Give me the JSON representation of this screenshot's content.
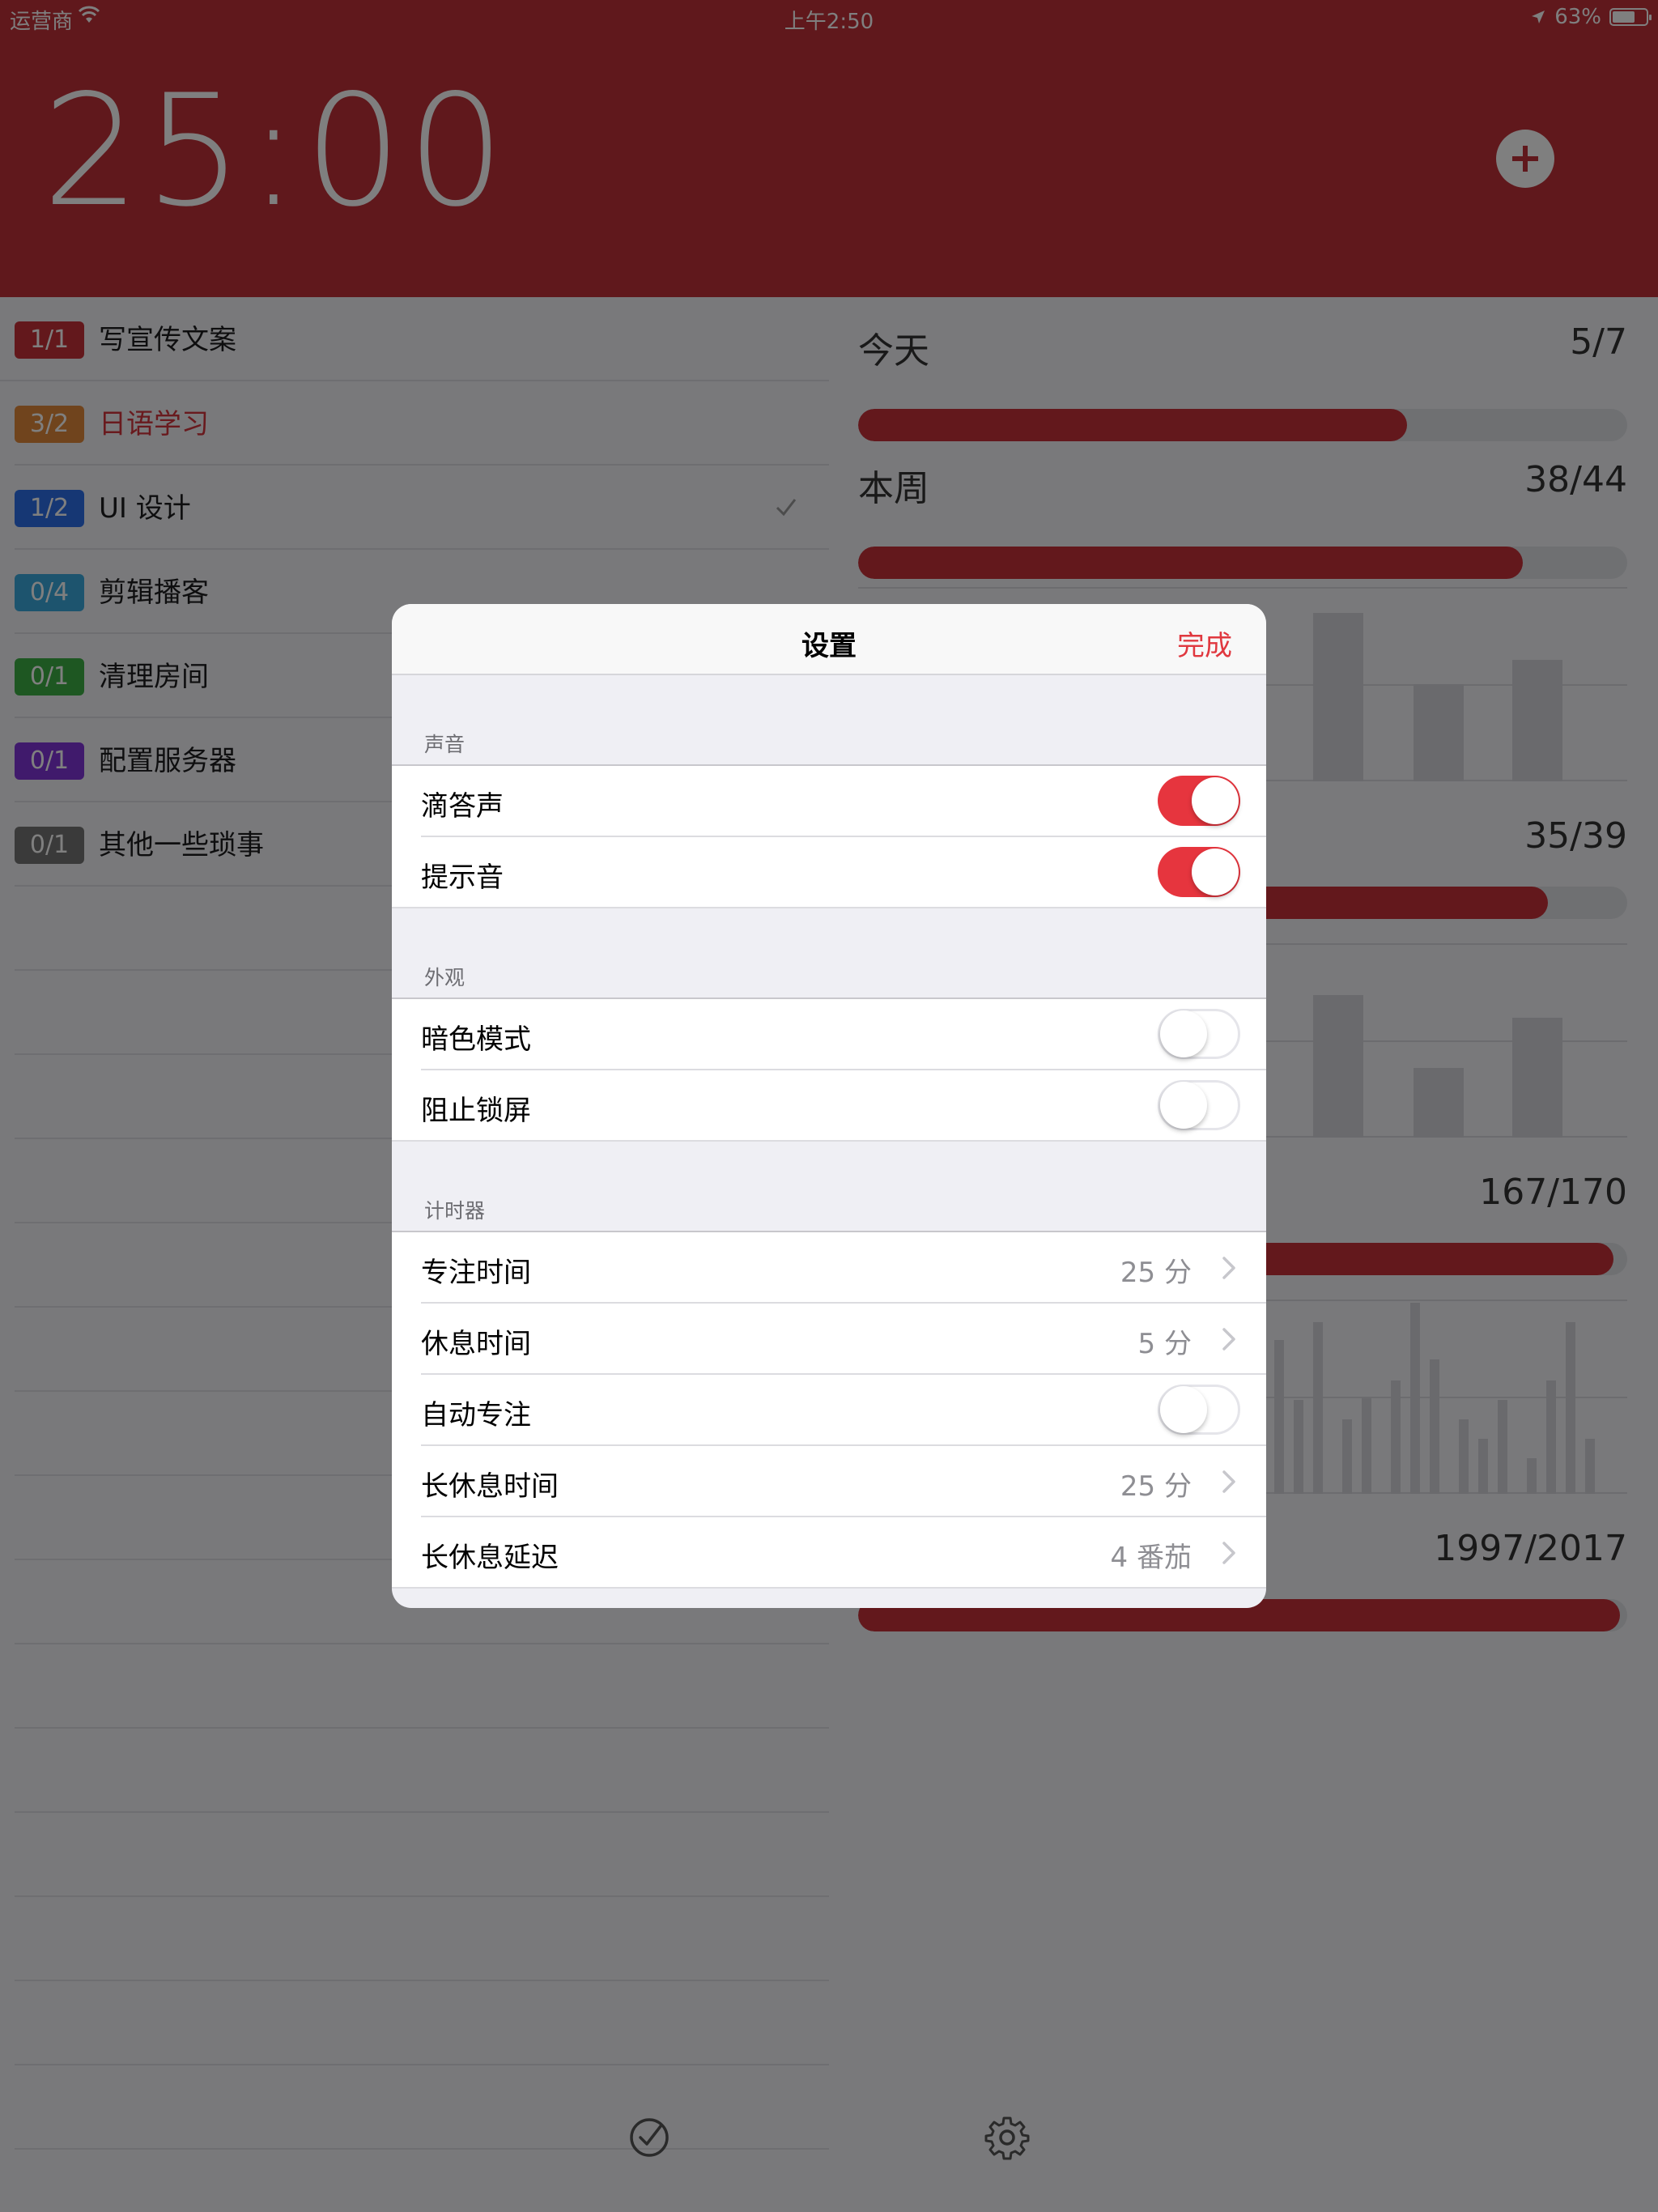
{
  "status_bar": {
    "carrier": "运营商",
    "time": "上午2:50",
    "battery": "63%"
  },
  "timer": {
    "value": "25:00"
  },
  "tasks": [
    {
      "badge": "1/1",
      "name": "写宣传文案",
      "color": "#c63038",
      "text_color": "#1c1c1e",
      "checked": false
    },
    {
      "badge": "3/2",
      "name": "日语学习",
      "color": "#e0883a",
      "text_color": "#d2343c",
      "checked": false
    },
    {
      "badge": "1/2",
      "name": "UI 设计",
      "color": "#2d6fe8",
      "text_color": "#1c1c1e",
      "checked": true
    },
    {
      "badge": "0/4",
      "name": "剪辑播客",
      "color": "#3aa9dc",
      "text_color": "#1c1c1e",
      "checked": false
    },
    {
      "badge": "0/1",
      "name": "清理房间",
      "color": "#3dae45",
      "text_color": "#1c1c1e",
      "checked": false
    },
    {
      "badge": "0/1",
      "name": "配置服务器",
      "color": "#8134d8",
      "text_color": "#1c1c1e",
      "checked": false
    },
    {
      "badge": "0/1",
      "name": "其他一些琐事",
      "color": "#757575",
      "text_color": "#1c1c1e",
      "checked": false
    }
  ],
  "stats": {
    "today": {
      "label": "今天",
      "value": "5/7",
      "progress": 0.714
    },
    "week": {
      "label": "本周",
      "value": "38/44",
      "progress": 0.864
    },
    "stat3": {
      "value": "35/39",
      "progress": 0.897
    },
    "stat4": {
      "value": "167/170",
      "progress": 0.982
    },
    "stat5": {
      "value": "1997/2017",
      "progress": 0.99
    }
  },
  "settings": {
    "title": "设置",
    "done": "完成",
    "sections": {
      "sound": {
        "header": "声音",
        "tick": {
          "label": "滴答声",
          "on": true
        },
        "alert": {
          "label": "提示音",
          "on": true
        }
      },
      "appearance": {
        "header": "外观",
        "dark": {
          "label": "暗色模式",
          "on": false
        },
        "lock": {
          "label": "阻止锁屏",
          "on": false
        }
      },
      "timer": {
        "header": "计时器",
        "focus": {
          "label": "专注时间",
          "value": "25 分"
        },
        "rest": {
          "label": "休息时间",
          "value": "5 分"
        },
        "auto": {
          "label": "自动专注",
          "on": false
        },
        "long_rest": {
          "label": "长休息时间",
          "value": "25 分"
        },
        "long_delay": {
          "label": "长休息延迟",
          "value": "4 番茄"
        }
      }
    }
  },
  "colors": {
    "accent": "#c03139",
    "toggle_on": "#e6353e",
    "done_text": "#e0383f"
  }
}
